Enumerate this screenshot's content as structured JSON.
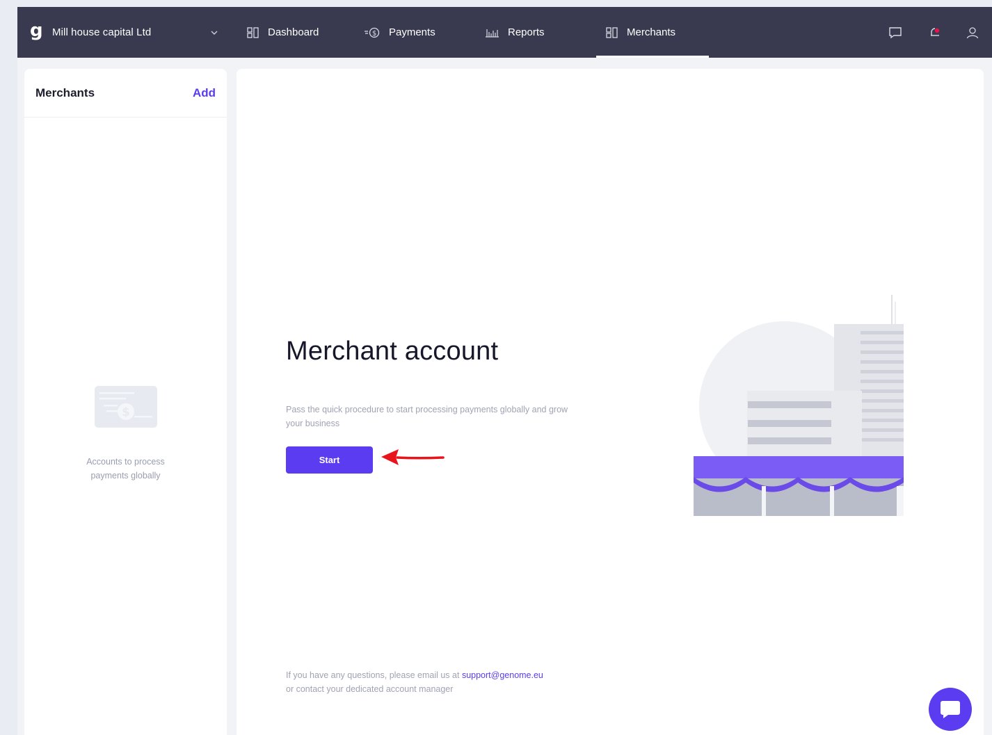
{
  "header": {
    "company_name": "Mill house capital Ltd",
    "nav": [
      {
        "label": "Dashboard",
        "icon": "dashboard-icon"
      },
      {
        "label": "Payments",
        "icon": "payments-icon"
      },
      {
        "label": "Reports",
        "icon": "reports-icon"
      },
      {
        "label": "Merchants",
        "icon": "merchants-icon",
        "active": true
      }
    ],
    "right_icons": [
      "chat-icon",
      "notification-bell-icon",
      "user-profile-icon"
    ]
  },
  "sidebar": {
    "title": "Merchants",
    "add_label": "Add",
    "empty_text": "Accounts to process payments globally",
    "empty_icon": "payment-card-icon"
  },
  "main": {
    "title": "Merchant account",
    "description": "Pass the quick procedure  to start processing payments globally and grow your business",
    "start_label": "Start",
    "footer_text": "If you have any questions, please email us at",
    "support_email": "support@genome.eu",
    "footer_text2": "or contact your dedicated account manager"
  },
  "colors": {
    "topbar": "#393a4f",
    "accent": "#5b3cf0",
    "background": "#e9edf3",
    "annotation_arrow": "#e8141b"
  }
}
